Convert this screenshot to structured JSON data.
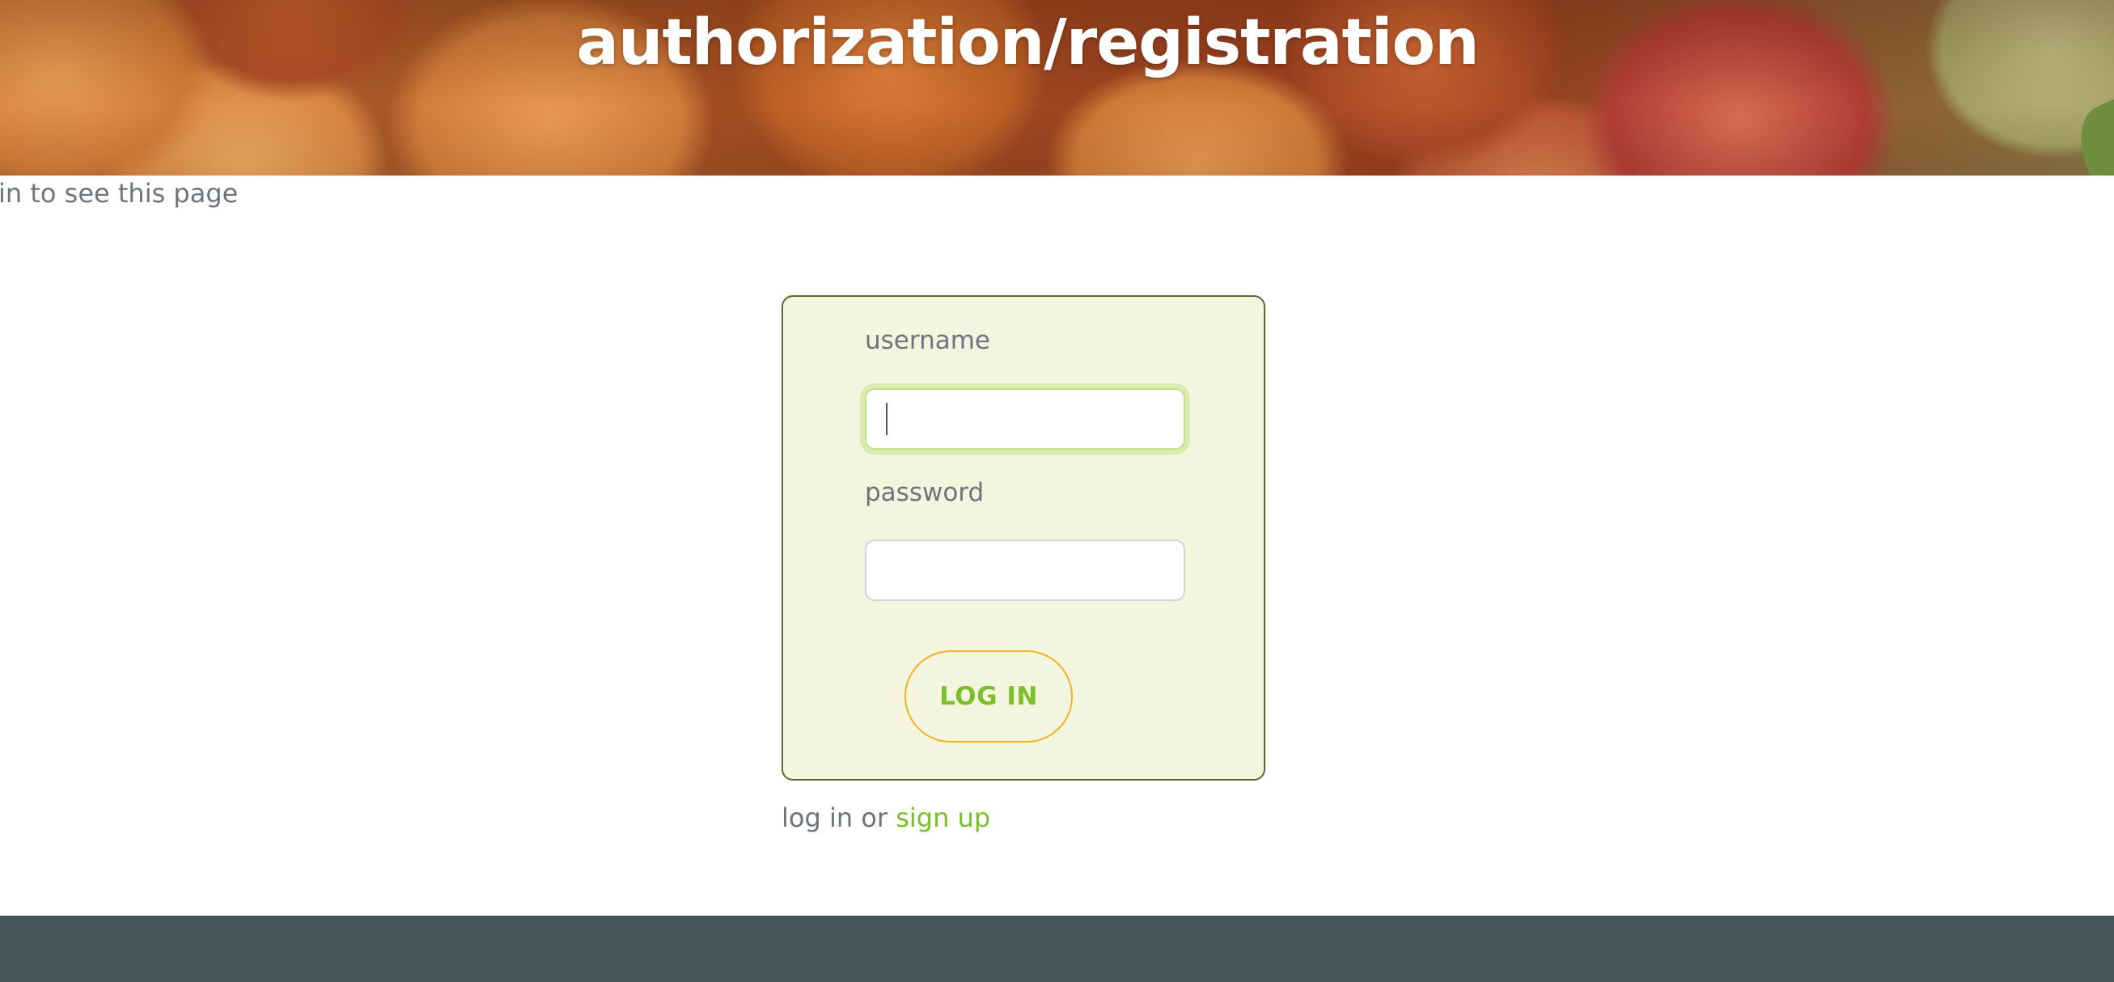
{
  "header": {
    "title": "authorization/registration"
  },
  "notice": {
    "text": "in to see this page"
  },
  "login_form": {
    "username_label": "username",
    "username_value": "",
    "password_label": "password",
    "password_value": "",
    "submit_label": "LOG IN"
  },
  "alt_links": {
    "prefix": "log in or",
    "signup_label": "sign up"
  },
  "colors": {
    "accent_green": "#7cbf2c",
    "button_border": "#f0b323",
    "card_background": "#f4f5df",
    "footer_background": "#46565b",
    "muted_text": "#6c757d"
  }
}
